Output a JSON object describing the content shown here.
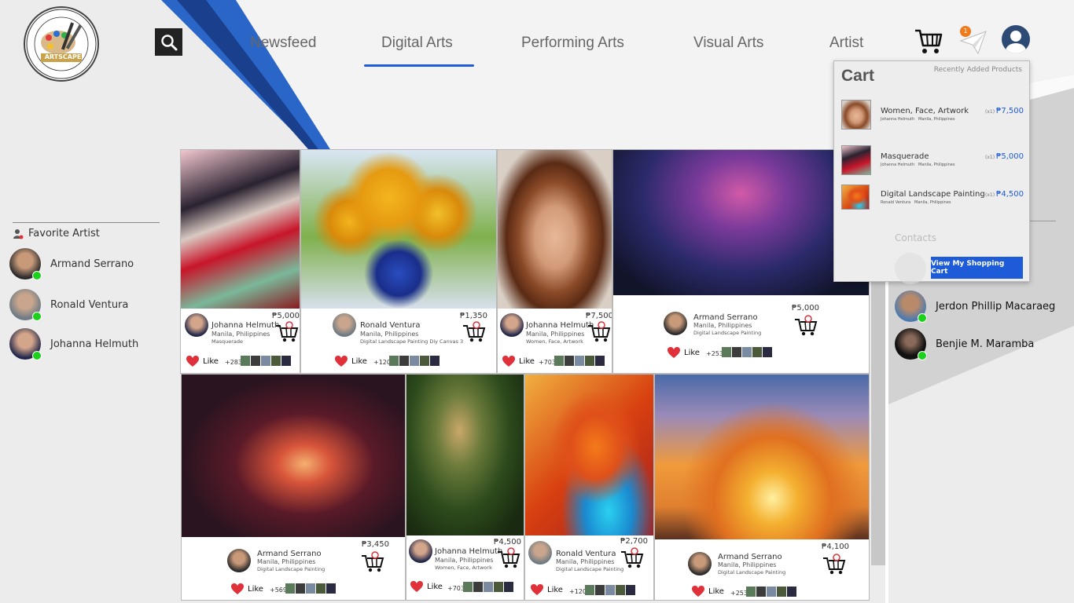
{
  "logo": {
    "text": "ARTSCAPE",
    "ring_text": "WHERE YOUR ART IS OUR ESCAPE"
  },
  "nav": {
    "items": [
      "Newsfeed",
      "Digital Arts",
      "Performing Arts",
      "Visual Arts",
      "Artist"
    ],
    "active": "Digital Arts"
  },
  "header_icons": {
    "cart": "cart-icon",
    "messages": "paper-plane-icon",
    "messages_badge": "1",
    "profile": "user-icon"
  },
  "favorites": {
    "heading": "Favorite Artist",
    "artists": [
      {
        "name": "Armand Serrano"
      },
      {
        "name": "Ronald Ventura"
      },
      {
        "name": "Johanna Helmuth"
      }
    ]
  },
  "cards": [
    {
      "artist": "Johanna Helmuth",
      "location": "Manila, Philippines",
      "desc": "Masquerade",
      "price": "₱5,000",
      "like": "Like",
      "count": "+283"
    },
    {
      "artist": "Ronald Ventura",
      "location": "Manila, Philippines",
      "desc": "Digital Landscape Painting Diy Canvas 3",
      "price": "₱1,350",
      "like": "Like",
      "count": "+120"
    },
    {
      "artist": "Johanna Helmuth",
      "location": "Manila, Philippines",
      "desc": "Women, Face, Artwork",
      "price": "₱7,500",
      "like": "Like",
      "count": "+703"
    },
    {
      "artist": "Armand Serrano",
      "location": "Manila, Philippines",
      "desc": "Digital Landscape Painting",
      "price": "₱5,000",
      "like": "Like",
      "count": "+253"
    },
    {
      "artist": "Armand Serrano",
      "location": "Manila, Philippines",
      "desc": "Digital Landscape Painting",
      "price": "₱3,450",
      "like": "Like",
      "count": "+569"
    },
    {
      "artist": "Johanna Helmuth",
      "location": "Manila, Philippines",
      "desc": "Women, Face, Artwork",
      "price": "₱4,500",
      "like": "Like",
      "count": "+703"
    },
    {
      "artist": "Ronald Ventura",
      "location": "Manila, Philippines",
      "desc": "Digital Landscape Painting",
      "price": "₱2,700",
      "like": "Like",
      "count": "+120"
    },
    {
      "artist": "Armand Serrano",
      "location": "Manila, Philippines",
      "desc": "Digital Landscape Painting",
      "price": "₱4,100",
      "like": "Like",
      "count": "+253"
    }
  ],
  "cart": {
    "title": "Cart",
    "recent_label": "Recently Added Products",
    "items": [
      {
        "name": "Women, Face, Artwork",
        "artist": "Johanna Helmuth",
        "location": "Manila, Philippines",
        "qty": "(x1)",
        "price": "₱7,500"
      },
      {
        "name": "Masquerade",
        "artist": "Johanna Helmuth",
        "location": "Manila, Philippines",
        "qty": "(x1)",
        "price": "₱5,000"
      },
      {
        "name": "Digital Landscape Painting",
        "artist": "Ronald Ventura",
        "location": "Manila, Philippines",
        "qty": "(x1)",
        "price": "₱4,500"
      }
    ],
    "contacts_label": "Contacts",
    "view_button": "View My Shopping Cart"
  },
  "contacts": [
    {
      "name": "Jerdon Phillip Macaraeg"
    },
    {
      "name": "Benjie M. Maramba"
    }
  ],
  "colors": {
    "accent": "#1e5bd8",
    "online": "#1bd11b",
    "like": "#e0303a",
    "badge": "#f07a1a"
  }
}
